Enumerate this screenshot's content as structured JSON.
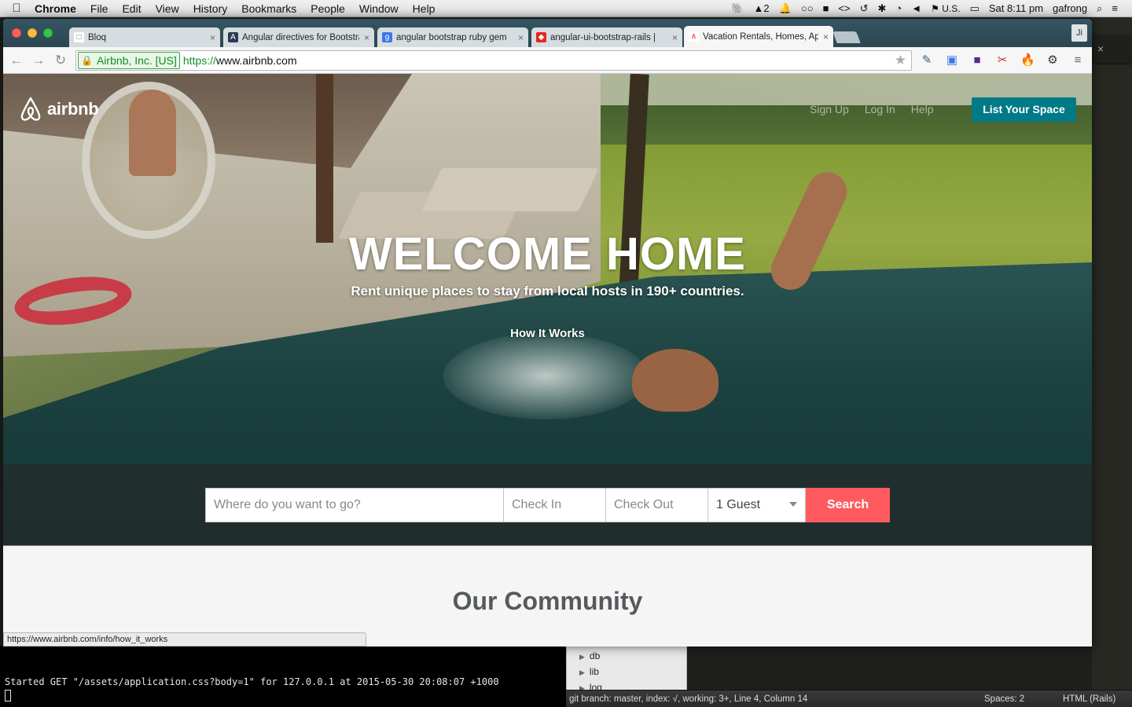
{
  "menubar": {
    "apple": "",
    "app_name": "Chrome",
    "items": [
      "File",
      "Edit",
      "View",
      "History",
      "Bookmarks",
      "People",
      "Window",
      "Help"
    ],
    "tray": {
      "adobe_count": "2",
      "input_source": "U.S.",
      "clock": "Sat 8:11 pm",
      "user": "gafrong"
    }
  },
  "browser": {
    "tabs": [
      {
        "title": "Bloq",
        "favicon": "page-icon",
        "active": false
      },
      {
        "title": "Angular directives for Bootstrap",
        "favicon": "angular-icon",
        "active": false
      },
      {
        "title": "angular bootstrap ruby gem",
        "favicon": "google-icon",
        "active": false
      },
      {
        "title": "angular-ui-bootstrap-rails |",
        "favicon": "rubygems-icon",
        "active": false
      },
      {
        "title": "Vacation Rentals, Homes, Apartments",
        "favicon": "airbnb-icon",
        "active": true
      }
    ],
    "tab_close": "×",
    "profile_initials": "Ji",
    "ev_certificate": "Airbnb, Inc. [US]",
    "url_scheme": "https://",
    "url_rest": "www.airbnb.com",
    "status_url": "https://www.airbnb.com/info/how_it_works"
  },
  "page": {
    "logo_text": "airbnb",
    "nav": {
      "sign_up": "Sign Up",
      "log_in": "Log In",
      "help": "Help",
      "list_space": "List Your Space"
    },
    "hero": {
      "headline": "WELCOME HOME",
      "tagline": "Rent unique places to stay from local hosts in 190+ countries.",
      "how_it_works": "How It Works"
    },
    "search": {
      "where_placeholder": "Where do you want to go?",
      "check_in": "Check In",
      "check_out": "Check Out",
      "guests": "1 Guest",
      "button": "Search"
    },
    "community_title": "Our Community",
    "colors": {
      "brand_teal": "#007a87",
      "brand_coral": "#ff5a5f"
    }
  },
  "terminal": {
    "log_line": "Started GET \"/assets/application.css?body=1\" for 127.0.0.1 at 2015-05-30 20:08:07 +1000"
  },
  "editor": {
    "tree": [
      "db",
      "lib",
      "log"
    ],
    "status_left": "git branch: master, index: √, working: 3+, Line 4, Column 14",
    "spaces": "Spaces: 2",
    "syntax": "HTML (Rails)"
  }
}
